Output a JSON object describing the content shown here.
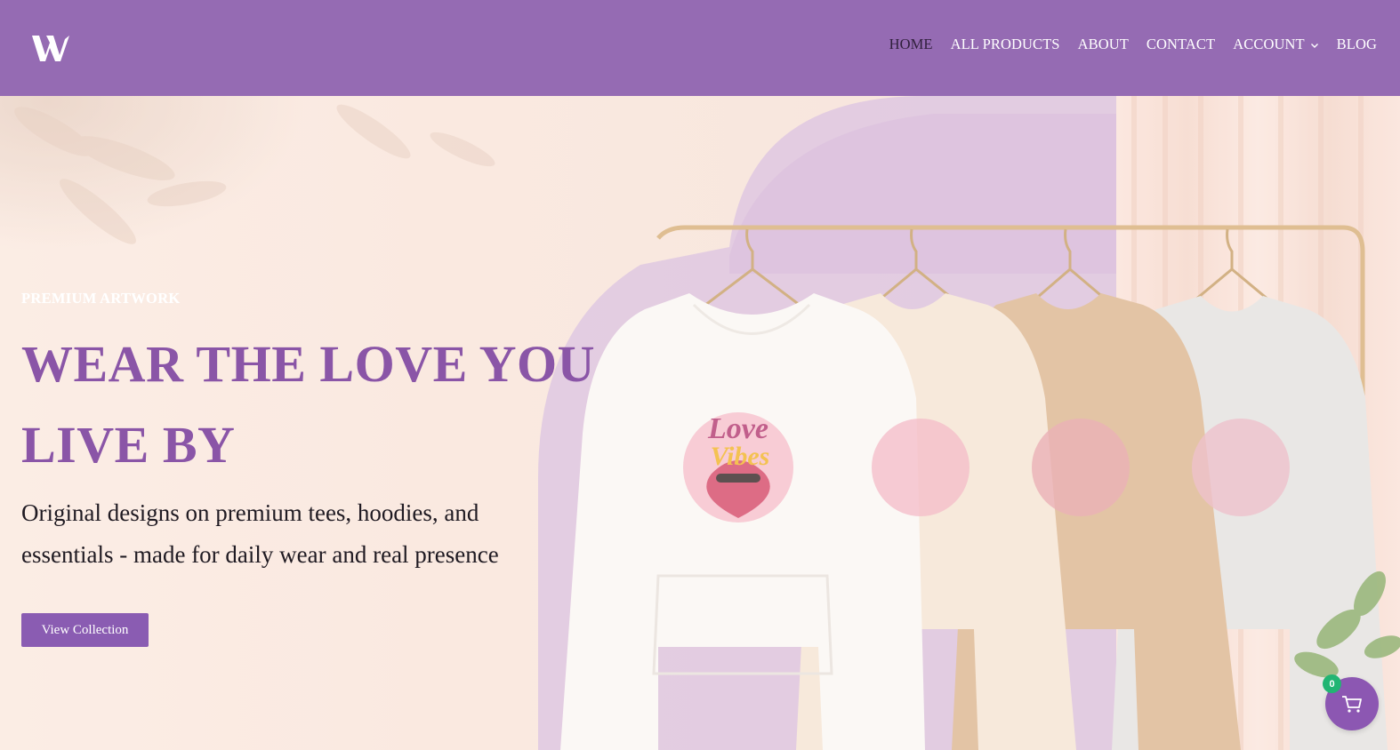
{
  "header": {
    "logo_icon": "w-logo-icon",
    "nav": [
      {
        "label": "HOME",
        "active": true
      },
      {
        "label": "ALL PRODUCTS"
      },
      {
        "label": "ABOUT"
      },
      {
        "label": "CONTACT"
      },
      {
        "label": "ACCOUNT",
        "dropdown": true
      },
      {
        "label": "BLOG"
      }
    ],
    "colors": {
      "bar": "#956bb3",
      "active_link": "#2f1f3b"
    }
  },
  "hero": {
    "eyebrow": "PREMIUM ARTWORK",
    "headline": "WEAR THE LOVE YOU LIVE BY",
    "subheadline": "Original designs on premium tees, hoodies, and essentials - made for daily wear and real presence",
    "cta_label": "View Collection",
    "image_logo_text": [
      "Love",
      "Vibes"
    ],
    "colors": {
      "headline": "#8a55a7",
      "cta": "#8a5cb2"
    }
  },
  "cart": {
    "count": "0",
    "icon": "cart-icon"
  }
}
